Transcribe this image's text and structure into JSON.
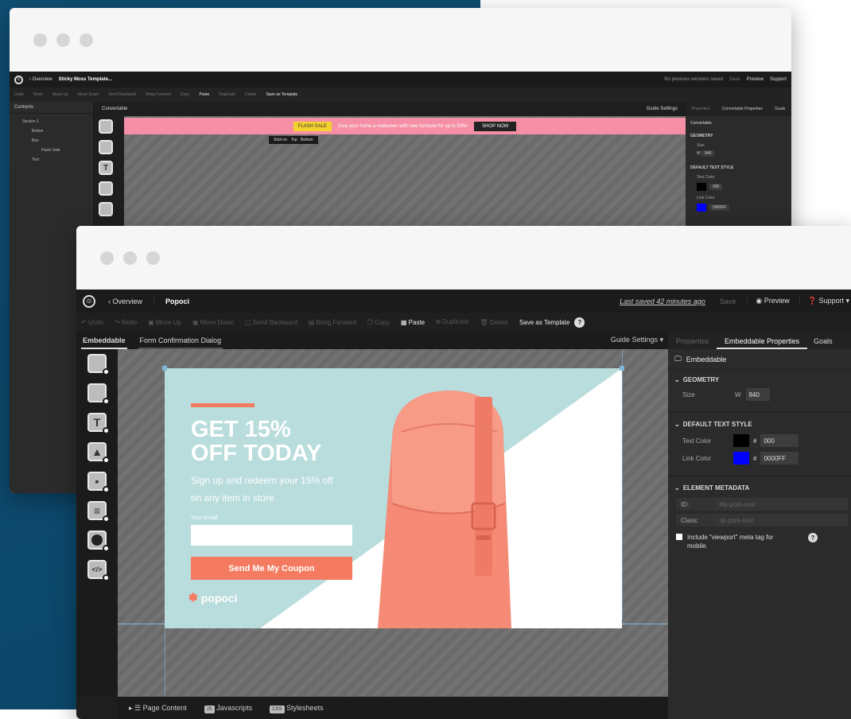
{
  "colors": {
    "brand_red": "#f47b60",
    "teal": "#b9dcdc",
    "pink_bar": "#f48fa6",
    "accent_blue": "#0000ff",
    "dark": "#1b1b1b"
  },
  "back": {
    "nav": {
      "back": "‹ Overview",
      "title": "Sticky Moss Template...",
      "status": "No previous versions saved",
      "save": "Save",
      "preview": "Preview",
      "support": "Support"
    },
    "toolbar": [
      "Undo",
      "Redo",
      "Move Up",
      "Move Down",
      "Send Backward",
      "Bring Forward",
      "Copy",
      "Paste",
      "Duplicate",
      "Delete",
      "Save as Template"
    ],
    "left_title": "Contents",
    "tree": [
      "Section 1",
      "Button",
      "Box",
      "Flash Sale",
      "Text"
    ],
    "tab": "Convertable",
    "guide": "Guide Settings",
    "banner": {
      "tag": "FLASH SALE",
      "text": "Give your home a makeover with new furniture for up to 50%!",
      "button": "SHOP NOW"
    },
    "stick": {
      "label": "Stick to:",
      "top": "Top",
      "bottom": "Bottom"
    },
    "right": {
      "tab1": "Properties",
      "tab2": "Convertable Properties",
      "tab3": "Goals",
      "head": "Convertable",
      "geometry": "GEOMETRY",
      "size": "Size",
      "w": "W",
      "w_val": "840",
      "text_style": "DEFAULT TEXT STYLE",
      "text_color": "Text Color",
      "text_val": "000",
      "link_color": "Link Color",
      "link_val": "0000FF"
    }
  },
  "front": {
    "nav": {
      "back": "‹ Overview",
      "title": "Popoci",
      "last_saved": "Last saved  42 minutes ago",
      "save": "Save",
      "preview": "Preview",
      "support": "Support"
    },
    "toolbar": {
      "undo": "Undo",
      "redo": "Redo",
      "move_up": "Move Up",
      "move_down": "Move Down",
      "send_backward": "Send Backward",
      "bring_forward": "Bring Forward",
      "copy": "Copy",
      "paste": "Paste",
      "duplicate": "Duplicate",
      "delete": "Delete",
      "save_template": "Save as Template",
      "help": "?"
    },
    "tabs": {
      "embeddable": "Embeddable",
      "form": "Form Confirmation Dialog",
      "guide": "Guide Settings"
    },
    "popup": {
      "headline1": "GET 15%",
      "headline2": "OFF TODAY",
      "sub1": "Sign up and redeem your 15% off",
      "sub2": "on any item in store.",
      "email_label": "Your Email",
      "email_placeholder": "",
      "cta": "Send Me My Coupon",
      "brand": "popoci"
    },
    "bottom": {
      "page_content": "Page Content",
      "js": "Javascripts",
      "css": "Stylesheets",
      "js_badge": "JS",
      "css_badge": "CSS"
    },
    "right": {
      "tab1": "Properties",
      "tab2": "Embeddable Properties",
      "tab3": "Goals",
      "head": "Embeddable",
      "geometry": "GEOMETRY",
      "size": "Size",
      "w": "W",
      "w_val": "840",
      "text_style": "DEFAULT TEXT STYLE",
      "text_color": "Text Color",
      "hash": "#",
      "text_val": "000",
      "link_color": "Link Color",
      "link_val": "0000FF",
      "metadata": "ELEMENT METADATA",
      "id_label": "ID:",
      "id_val": "#lp-pom-root",
      "class_label": "Class:",
      "class_val": ".lp-pom-root",
      "viewport": "Include \"viewport\" meta tag for mobile.",
      "help": "?"
    }
  }
}
